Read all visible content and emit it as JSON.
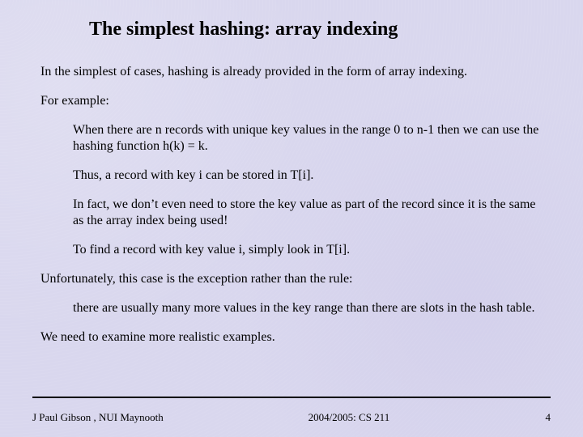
{
  "title": "The simplest hashing: array indexing",
  "paragraphs": {
    "p1": "In the simplest of cases, hashing is already provided in the form of array indexing.",
    "p2": "For example:",
    "p3": "When there are n records with unique key values in the range 0 to n-1 then we can use the hashing function h(k) = k.",
    "p4": "Thus, a record with key i can be stored in T[i].",
    "p5": "In fact, we don’t even need to store the key value as part of the record since it is the same as the array index being used!",
    "p6": "To find a record with key value i, simply look in T[i].",
    "p7": "Unfortunately, this case is the exception rather than the rule:",
    "p8": "there are usually many more values in the key range than there are slots in the hash table.",
    "p9": "We need to examine more realistic examples."
  },
  "footer": {
    "author": "J Paul Gibson , NUI Maynooth",
    "course": "2004/2005: CS 211",
    "page": "4"
  }
}
